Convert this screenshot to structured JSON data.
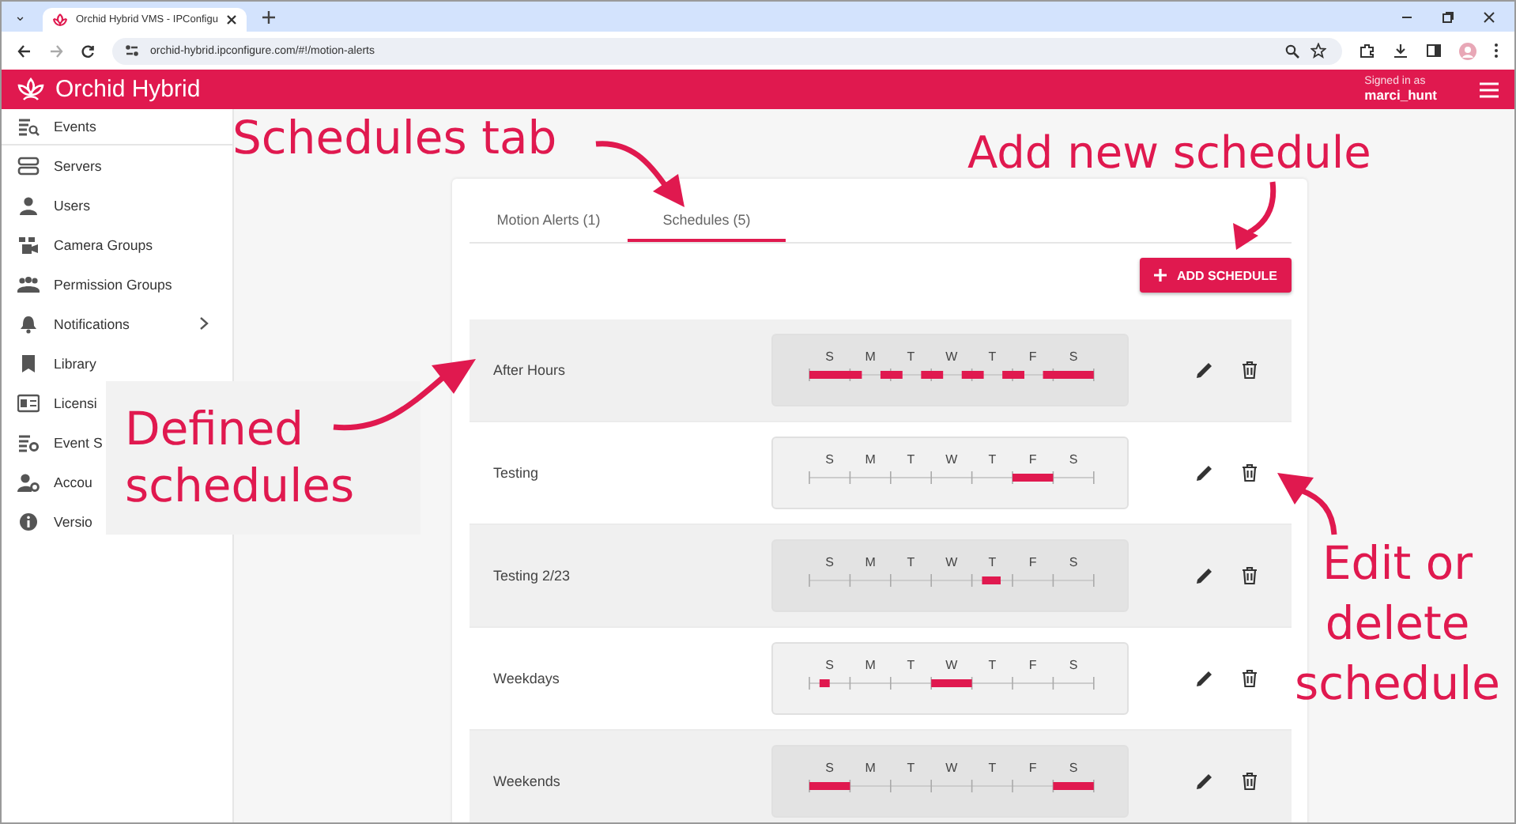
{
  "browser": {
    "tab_list": "⌄",
    "tab_title": "Orchid Hybrid VMS - IPConfigu",
    "address": "orchid-hybrid.ipconfigure.com/#!/motion-alerts"
  },
  "header": {
    "app_name": "Orchid Hybrid",
    "signed_in_label": "Signed in as",
    "username": "marci_hunt"
  },
  "sidebar": {
    "items": [
      {
        "label": "Events",
        "kind": "events"
      },
      {
        "label": "Servers",
        "kind": "servers"
      },
      {
        "label": "Users",
        "kind": "users"
      },
      {
        "label": "Camera Groups",
        "kind": "cameras"
      },
      {
        "label": "Permission Groups",
        "kind": "groups"
      },
      {
        "label": "Notifications",
        "kind": "bell",
        "expandable": true
      },
      {
        "label": "Library",
        "kind": "bookmark"
      },
      {
        "label": "Licensi",
        "kind": "license"
      },
      {
        "label": "Event S",
        "kind": "events-settings"
      },
      {
        "label": "Accou",
        "kind": "account"
      },
      {
        "label": "Versio",
        "kind": "info"
      }
    ]
  },
  "tabs": [
    {
      "label": "Motion Alerts (1)",
      "selected": false
    },
    {
      "label": "Schedules (5)",
      "selected": true
    }
  ],
  "add_button": "ADD SCHEDULE",
  "schedules": [
    {
      "name": "After Hours",
      "days": [
        "S",
        "M",
        "T",
        "W",
        "T",
        "F",
        "S"
      ]
    },
    {
      "name": "Testing",
      "days": [
        "S",
        "M",
        "T",
        "W",
        "T",
        "F",
        "S"
      ]
    },
    {
      "name": "Testing 2/23",
      "days": [
        "S",
        "M",
        "T",
        "W",
        "T",
        "F",
        "S"
      ]
    },
    {
      "name": "Weekdays",
      "days": [
        "S",
        "M",
        "T",
        "W",
        "T",
        "F",
        "S"
      ]
    },
    {
      "name": "Weekends",
      "days": [
        "S",
        "M",
        "T",
        "W",
        "T",
        "F",
        "S"
      ]
    }
  ],
  "annotations": {
    "schedules_tab": "Schedules tab",
    "add_new": "Add new schedule",
    "defined": [
      "Defined",
      "schedules"
    ],
    "edit_delete": [
      "Edit or",
      "delete",
      "schedule"
    ]
  }
}
